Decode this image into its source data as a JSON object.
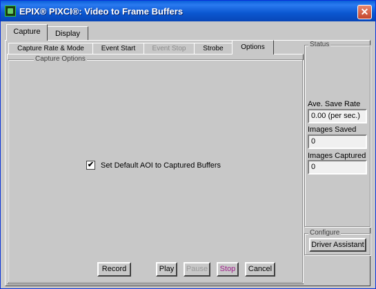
{
  "window": {
    "title": "EPIX® PIXCI®: Video to Frame Buffers",
    "close_glyph": "✕",
    "app_icon": "epix-app-icon"
  },
  "top_tabs": [
    {
      "label": "Capture",
      "active": true
    },
    {
      "label": "Display",
      "active": false
    }
  ],
  "inner_tabs": [
    {
      "label": "Capture Rate & Mode",
      "active": false,
      "enabled": true
    },
    {
      "label": "Event Start",
      "active": false,
      "enabled": true
    },
    {
      "label": "Event Stop",
      "active": false,
      "enabled": false
    },
    {
      "label": "Strobe",
      "active": false,
      "enabled": true
    },
    {
      "label": "Options",
      "active": true,
      "enabled": true
    }
  ],
  "capture_options": {
    "group_label": "Capture Options",
    "default_aoi_checkbox": {
      "label": "Set Default AOI to Captured Buffers",
      "checked": true,
      "glyph": "✔"
    }
  },
  "status": {
    "group_label": "Status",
    "ave_save_rate_label": "Ave. Save Rate",
    "ave_save_rate_value": "0.00 (per sec.)",
    "images_saved_label": "Images Saved",
    "images_saved_value": "0",
    "images_captured_label": "Images Captured",
    "images_captured_value": "0"
  },
  "configure": {
    "group_label": "Configure",
    "driver_assistant_label": "Driver Assistant"
  },
  "buttons": {
    "record": "Record",
    "play": "Play",
    "pause": "Pause",
    "stop": "Stop",
    "cancel": "Cancel"
  },
  "colors": {
    "titlebar": "#0a5fd8",
    "window_bg": "#c8c8c8",
    "stop_text": "#a0208c",
    "disabled_text": "#9a9a9a"
  }
}
